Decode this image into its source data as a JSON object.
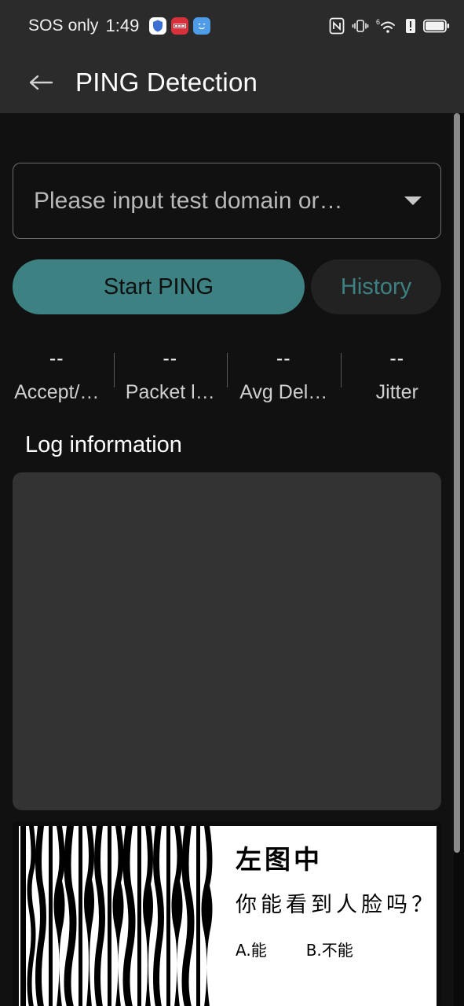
{
  "status_bar": {
    "carrier": "SOS only",
    "time": "1:49",
    "notification_icons": [
      "shield-icon",
      "red-app-icon",
      "blue-face-icon"
    ],
    "red_badge_text": "",
    "right_icons": [
      "nfc-icon",
      "vibrate-icon",
      "wifi6-icon",
      "alert-icon",
      "battery-icon"
    ],
    "wifi_generation": "6"
  },
  "app_bar": {
    "back_label": "back",
    "title": "PING Detection"
  },
  "form": {
    "domain_placeholder": "Please input test domain or…",
    "domain_value": "",
    "dropdown_icon": "chevron-down-icon"
  },
  "buttons": {
    "start_label": "Start PING",
    "history_label": "History"
  },
  "stats": [
    {
      "value": "--",
      "label": "Accept/…"
    },
    {
      "value": "--",
      "label": "Packet l…"
    },
    {
      "value": "--",
      "label": "Avg Del…"
    },
    {
      "value": "--",
      "label": "Jitter"
    }
  ],
  "log": {
    "title": "Log information",
    "content": ""
  },
  "ad": {
    "line1": "左图中",
    "line2": "你能看到人脸吗？",
    "option_a": "A.能",
    "option_b": "B.不能"
  },
  "colors": {
    "accent": "#3E8183",
    "app_bar": "#2B2B2B",
    "background": "#111111",
    "log_box": "#333333",
    "history_bg": "#222222"
  }
}
